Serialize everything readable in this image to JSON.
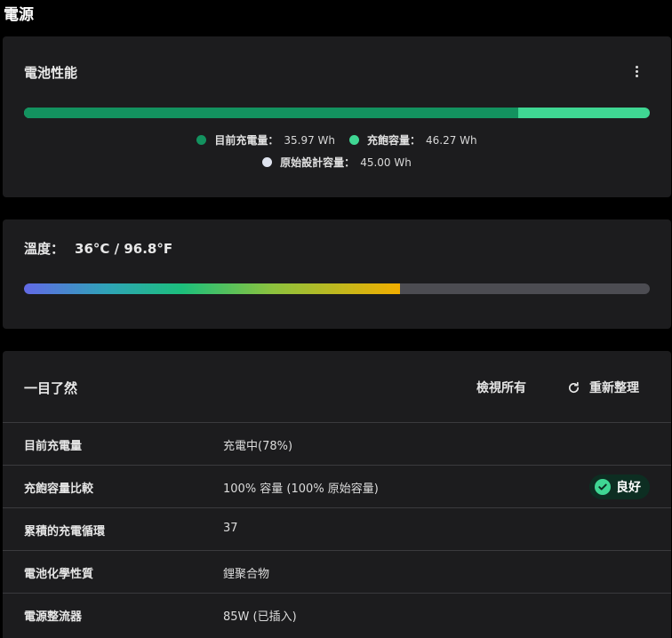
{
  "page": {
    "title": "電源"
  },
  "battery_card": {
    "title": "電池性能",
    "current_fraction": 0.7904,
    "legend": [
      {
        "label": "目前充電量：",
        "value": "35.97 Wh",
        "color": "#13925f"
      },
      {
        "label": "充飽容量：",
        "value": "46.27 Wh",
        "color": "#3fd693"
      },
      {
        "label": "原始設計容量：",
        "value": "45.00 Wh",
        "color": "#dfe3ee"
      }
    ]
  },
  "temp_card": {
    "label": "溫度：",
    "value": "36°C / 96.8°F",
    "level_fraction": 0.601
  },
  "glance_card": {
    "title": "一目了然",
    "view_all": "檢視所有",
    "refresh": "重新整理",
    "rows": [
      {
        "label": "目前充電量",
        "value": "充電中(78%)"
      },
      {
        "label": "充飽容量比較",
        "value": "100% 容量 (100% 原始容量)",
        "badge": "良好"
      },
      {
        "label": "累積的充電循環",
        "value": "37"
      },
      {
        "label": "電池化學性質",
        "value": "鋰聚合物"
      },
      {
        "label": "電源整流器",
        "value": "85W (已插入)"
      }
    ]
  },
  "colors": {
    "accent": "#3fd693",
    "card_bg": "#1c1c1e",
    "badge_bg": "#0d2e22"
  }
}
